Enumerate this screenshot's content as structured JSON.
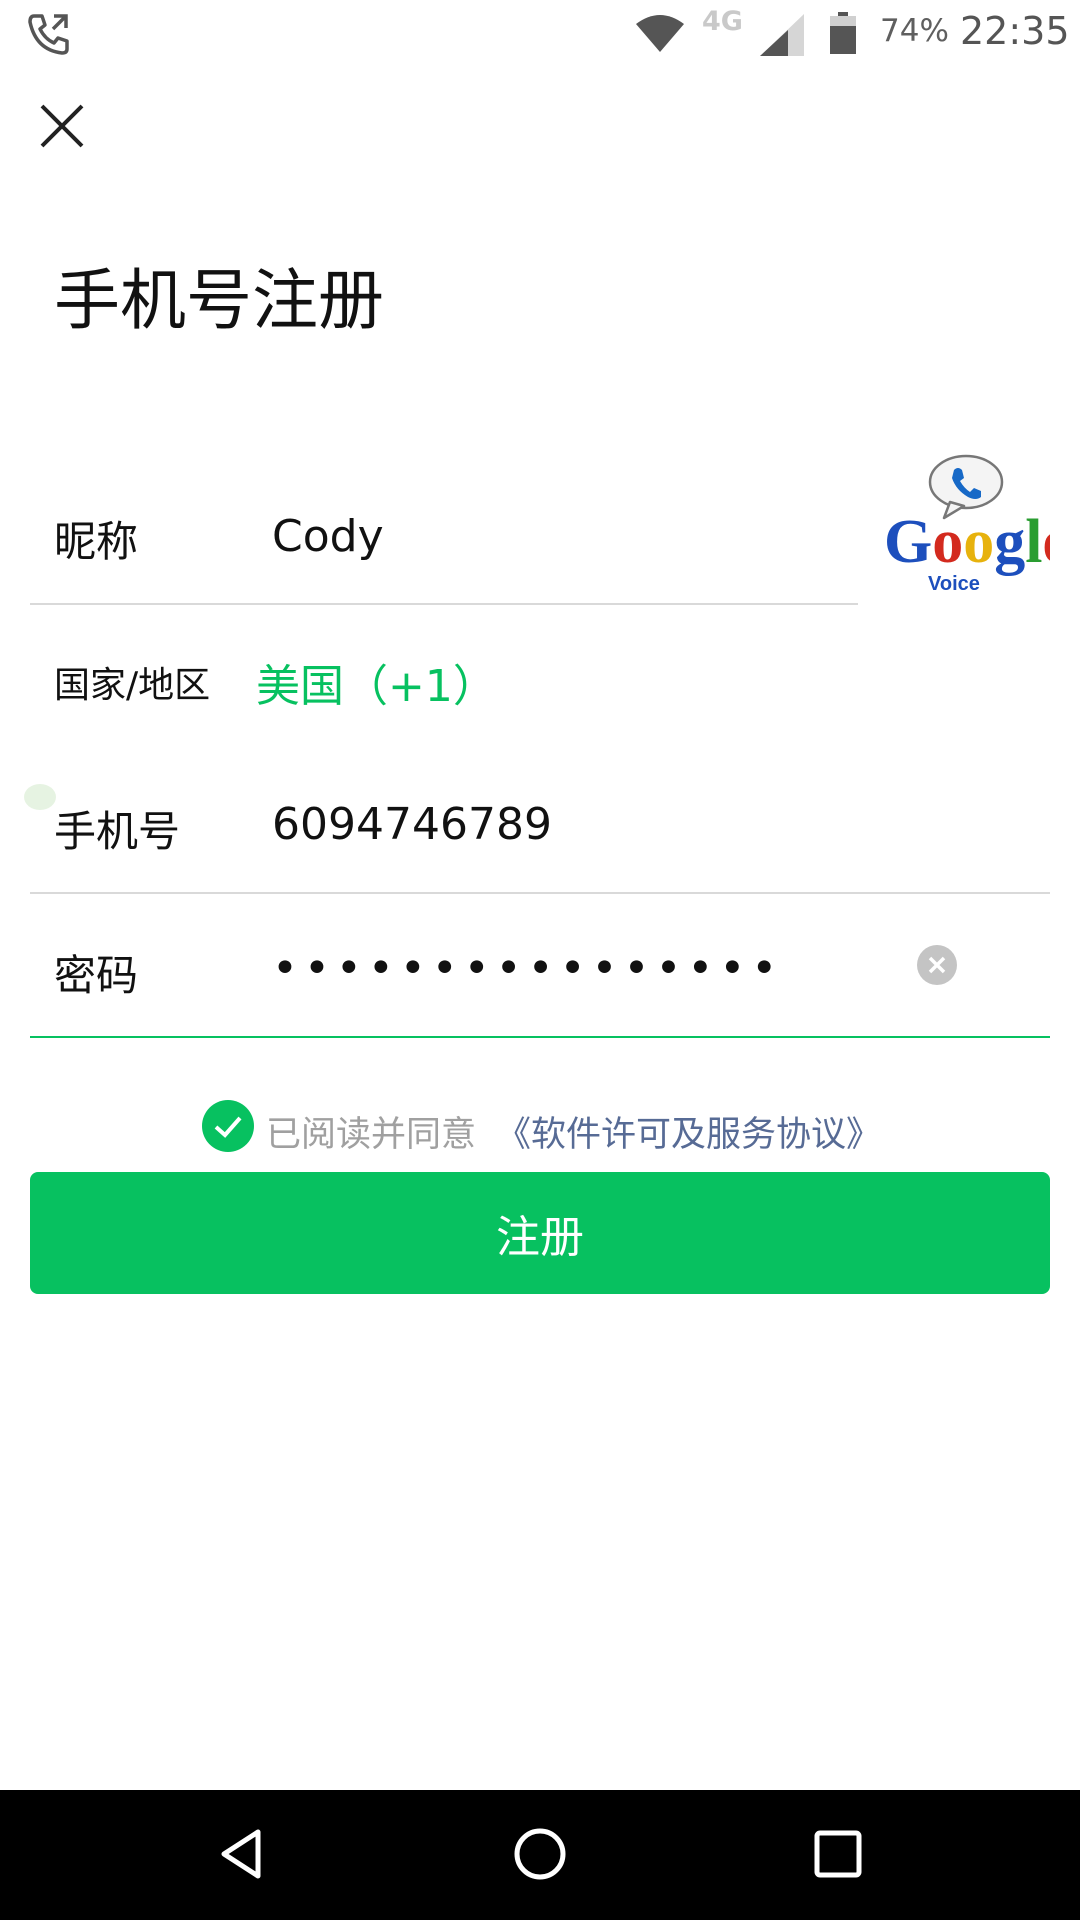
{
  "status_bar": {
    "network": "4G",
    "battery_percent": "74%",
    "time": "22:35",
    "icons": [
      "call-forward-icon",
      "wifi-icon",
      "signal-icon",
      "battery-icon"
    ]
  },
  "header": {
    "close_icon": "close-icon",
    "title": "手机号注册"
  },
  "form": {
    "nickname": {
      "label": "昵称",
      "value": "Cody"
    },
    "country": {
      "label": "国家/地区",
      "value": "美国（+1）"
    },
    "phone": {
      "label": "手机号",
      "value": "6094746789"
    },
    "password": {
      "label": "密码",
      "value": "••••••••••••••••",
      "clear_icon": "clear-icon"
    }
  },
  "logo": {
    "text": "Google",
    "subtext": "Voice"
  },
  "agreement": {
    "checked": true,
    "text": "已阅读并同意",
    "link": "《软件许可及服务协议》"
  },
  "register_button": {
    "label": "注册"
  },
  "colors": {
    "accent": "#07c160",
    "link": "#576b95",
    "text": "#111111",
    "muted": "#a0a0a0"
  },
  "nav_bar": {
    "icons": [
      "back-icon",
      "home-icon",
      "recent-apps-icon"
    ]
  }
}
